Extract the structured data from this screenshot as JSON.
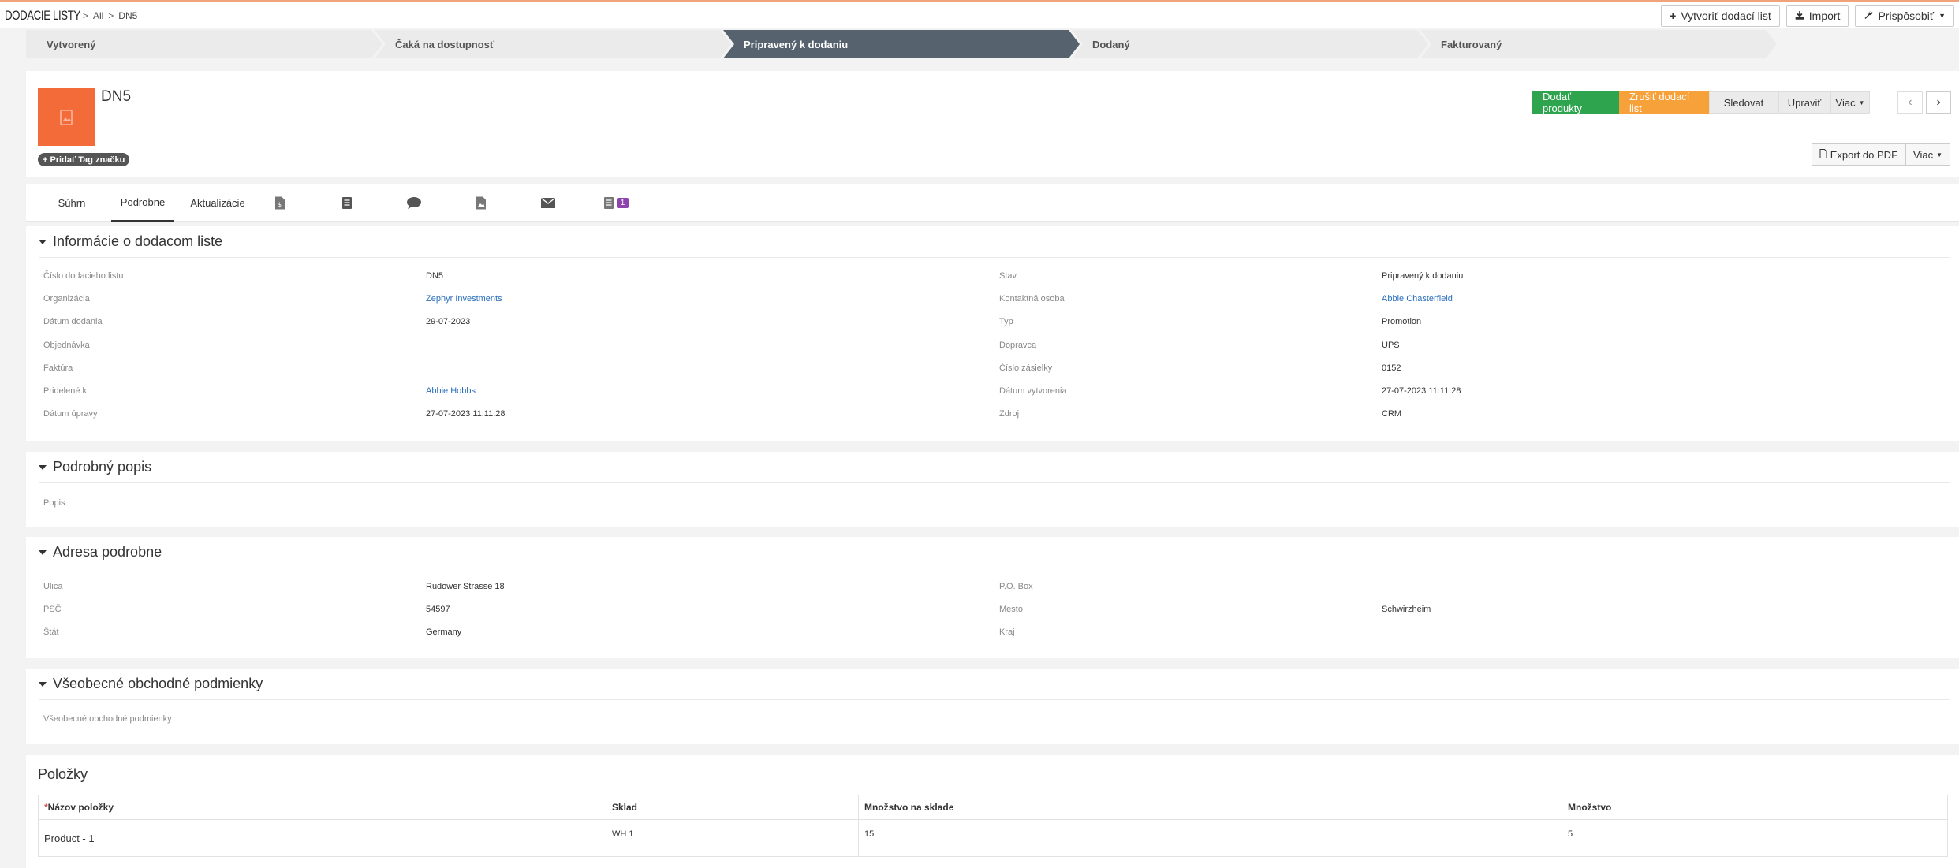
{
  "breadcrumb": {
    "module": "Dodacie listy",
    "all": "All",
    "record": "DN5"
  },
  "top_buttons": {
    "create": "Vytvoriť dodací list",
    "import": "Import",
    "customize": "Prispôsobiť"
  },
  "stages": [
    "Vytvorený",
    "Čaká na dostupnosť",
    "Pripravený k dodaniu",
    "Dodaný",
    "Fakturovaný"
  ],
  "active_stage": 2,
  "record": {
    "name": "DN5",
    "tag_button": "Pridať Tag značku"
  },
  "actions": {
    "deliver": "Dodať produkty",
    "cancel": "Zrušiť dodací list",
    "follow": "Sledovat",
    "edit": "Upraviť",
    "more": "Viac",
    "export_pdf": "Export do PDF",
    "export_more": "Viac"
  },
  "tabs": {
    "summary": "Súhrn",
    "details": "Podrobne",
    "updates": "Aktualizácie",
    "badge_count": "1"
  },
  "info_section": {
    "title": "Informácie o dodacom liste",
    "left": [
      {
        "label": "Číslo dodacieho listu",
        "value": "DN5"
      },
      {
        "label": "Organizácia",
        "value": "Zephyr Investments"
      },
      {
        "label": "Dátum dodania",
        "value": "29-07-2023"
      },
      {
        "label": "Objednávka",
        "value": ""
      },
      {
        "label": "Faktúra",
        "value": ""
      },
      {
        "label": "Pridelené k",
        "value": "Abbie Hobbs"
      },
      {
        "label": "Dátum úpravy",
        "value": "27-07-2023 11:11:28"
      }
    ],
    "right": [
      {
        "label": "Stav",
        "value": "Pripravený k dodaniu"
      },
      {
        "label": "Kontaktná osoba",
        "value": "Abbie Chasterfield"
      },
      {
        "label": "Typ",
        "value": "Promotion"
      },
      {
        "label": "Dopravca",
        "value": "UPS"
      },
      {
        "label": "Číslo zásielky",
        "value": "0152"
      },
      {
        "label": "Dátum vytvorenia",
        "value": "27-07-2023 11:11:28"
      },
      {
        "label": "Zdroj",
        "value": "CRM"
      }
    ]
  },
  "description_section": {
    "title": "Podrobný popis",
    "label": "Popis"
  },
  "address_section": {
    "title": "Adresa podrobne",
    "left": [
      {
        "label": "Ulica",
        "value": "Rudower Strasse 18"
      },
      {
        "label": "PSČ",
        "value": "54597"
      },
      {
        "label": "Štát",
        "value": "Germany"
      }
    ],
    "right": [
      {
        "label": "P.O. Box",
        "value": ""
      },
      {
        "label": "Mesto",
        "value": "Schwirzheim"
      },
      {
        "label": "Kraj",
        "value": ""
      }
    ]
  },
  "terms_section": {
    "title": "Všeobecné obchodné podmienky",
    "label": "Všeobecné obchodné podmienky"
  },
  "items_section": {
    "title": "Položky",
    "columns": [
      "Názov položky",
      "Sklad",
      "Množstvo na sklade",
      "Množstvo"
    ],
    "rows": [
      {
        "name": "Product - 1",
        "warehouse": "WH 1",
        "stock": "15",
        "qty": "5"
      }
    ]
  }
}
